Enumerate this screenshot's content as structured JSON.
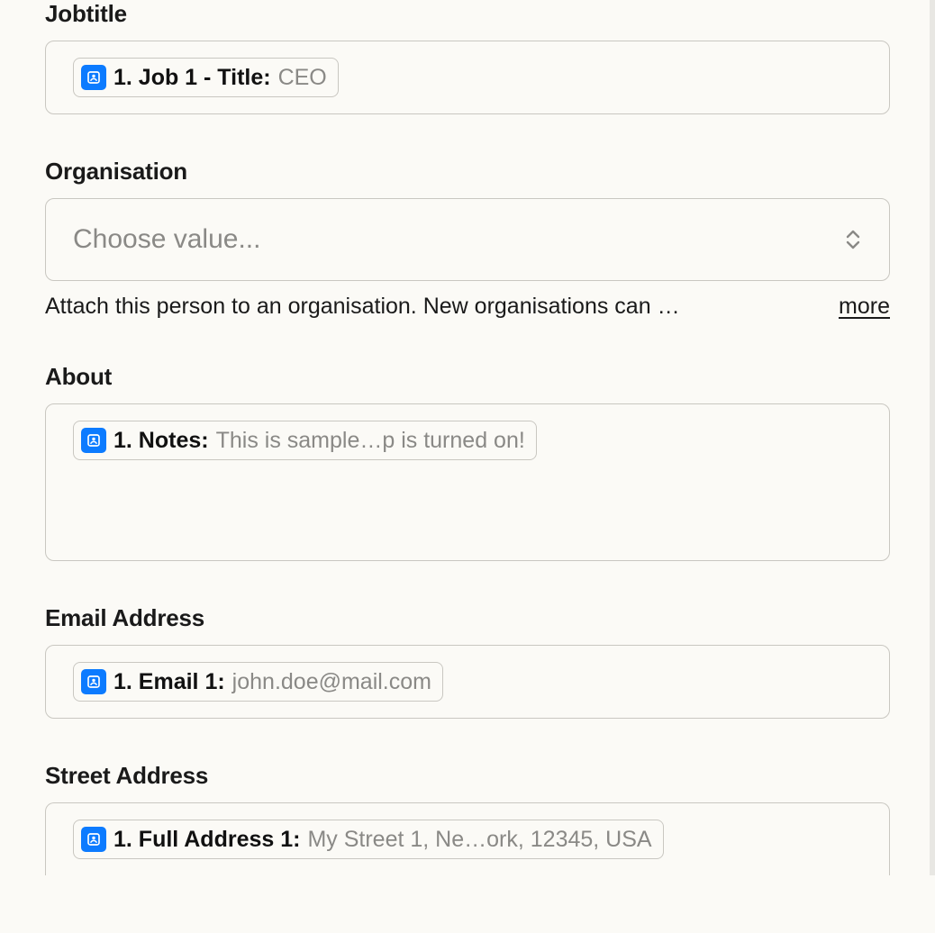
{
  "fields": {
    "jobtitle": {
      "label": "Jobtitle",
      "token": {
        "label": "1. Job 1 - Title:",
        "value": "CEO"
      }
    },
    "organisation": {
      "label": "Organisation",
      "placeholder": "Choose value...",
      "helper": "Attach this person to an organisation. New organisations can …",
      "more": "more"
    },
    "about": {
      "label": "About",
      "token": {
        "label": "1. Notes:",
        "value": "This is sample…p is turned on!"
      }
    },
    "email": {
      "label": "Email Address",
      "token": {
        "label": "1. Email 1:",
        "value": "john.doe@mail.com"
      }
    },
    "street": {
      "label": "Street Address",
      "token": {
        "label": "1. Full Address 1:",
        "value": "My Street 1, Ne…ork, 12345, USA"
      }
    }
  }
}
